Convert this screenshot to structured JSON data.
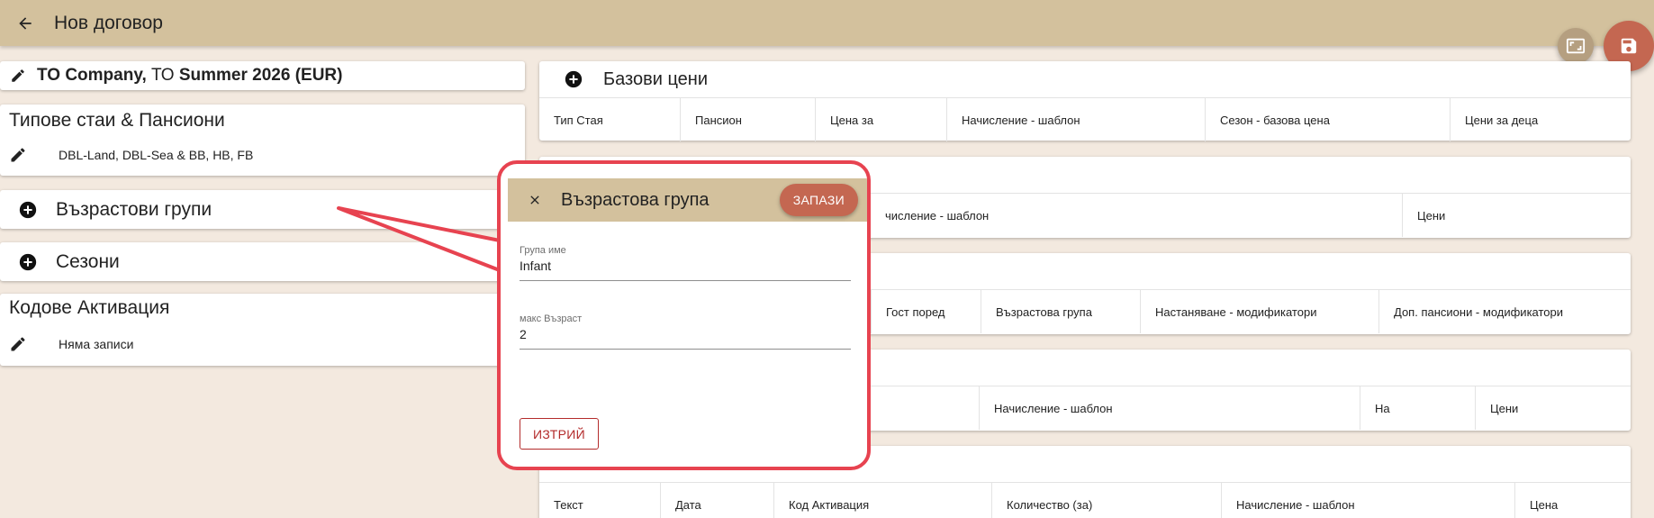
{
  "topbar": {
    "title": "Нов договор",
    "back_icon": "arrow-left-icon"
  },
  "fabs": {
    "fullscreen_icon": "fullscreen-icon",
    "save_icon": "save-icon"
  },
  "contract": {
    "operator": "TO Company,",
    "prefix": "ТО",
    "name": "Summer 2026 (EUR)"
  },
  "left": {
    "rooms": {
      "title": "Типове стаи & Пансиони",
      "value": "DBL-Land, DBL-Sea & BB, HB, FB"
    },
    "age_groups": {
      "title": "Възрастови групи"
    },
    "seasons": {
      "title": "Сезони"
    },
    "codes": {
      "title": "Кодове Активация",
      "value": "Няма записи"
    }
  },
  "right": {
    "base_prices": {
      "title": "Базови цени",
      "columns": [
        "Тип Стая",
        "Пансион",
        "Цена за",
        "Начисление - шаблон",
        "Сезон - базова цена",
        "Цени за деца"
      ]
    },
    "card2": {
      "columns": [
        "числение - шаблон",
        "Цени"
      ]
    },
    "card3": {
      "columns": [
        "Гост поред",
        "Възрастова група",
        "Настаняване - модификатори",
        "Доп. пансиони - модификатори"
      ]
    },
    "card4": {
      "columns": [
        "Начисление - шаблон",
        "На",
        "Цени"
      ]
    },
    "card5": {
      "columns": [
        "Текст",
        "Дата",
        "Код Активация",
        "Количество (за)",
        "Начисление - шаблон",
        "Цена"
      ]
    }
  },
  "dialog": {
    "title": "Възрастова група",
    "save_label": "ЗАПАЗИ",
    "group_name_label": "Група име",
    "group_name_value": "Infant",
    "max_age_label": "макс Възраст",
    "max_age_value": "2",
    "delete_label": "ИЗТРИЙ"
  },
  "colors": {
    "header": "#d3c19d",
    "accent": "#c46751",
    "callout": "#e74350",
    "background": "#f3e9df"
  }
}
